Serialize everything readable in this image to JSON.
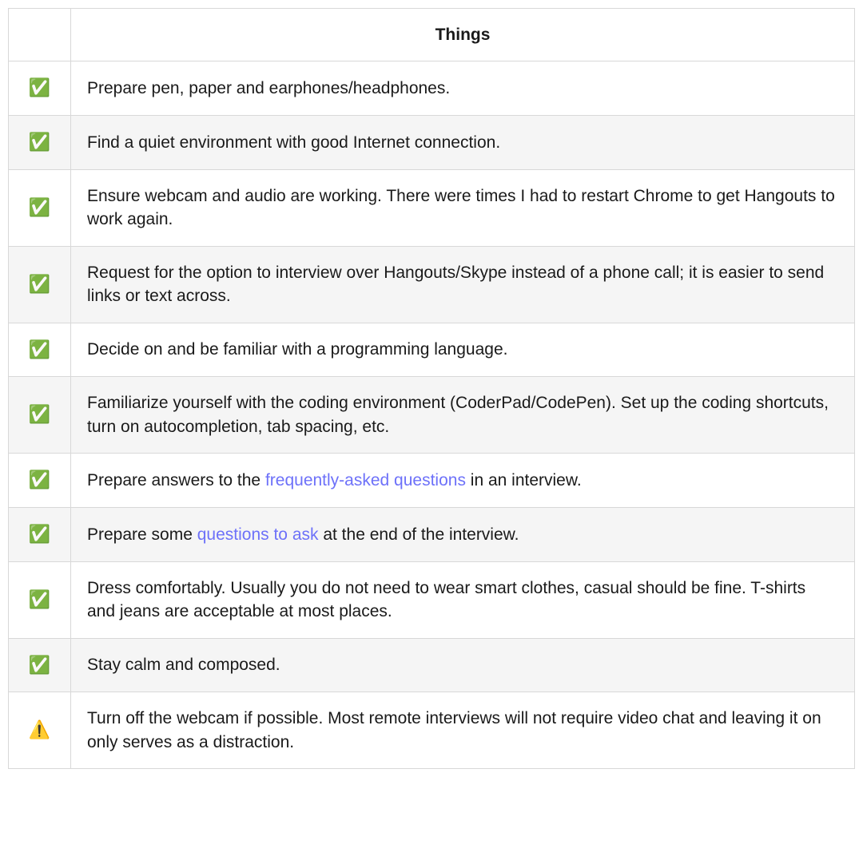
{
  "table": {
    "header": {
      "col1": "",
      "col2": "Things"
    },
    "icons": {
      "check": "✅",
      "warn": "⚠️"
    },
    "rows": [
      {
        "icon": "check",
        "segments": [
          {
            "type": "text",
            "text": "Prepare pen, paper and earphones/headphones."
          }
        ]
      },
      {
        "icon": "check",
        "segments": [
          {
            "type": "text",
            "text": "Find a quiet environment with good Internet connection."
          }
        ]
      },
      {
        "icon": "check",
        "segments": [
          {
            "type": "text",
            "text": "Ensure webcam and audio are working. There were times I had to restart Chrome to get Hangouts to work again."
          }
        ]
      },
      {
        "icon": "check",
        "segments": [
          {
            "type": "text",
            "text": "Request for the option to interview over Hangouts/Skype instead of a phone call; it is easier to send links or text across."
          }
        ]
      },
      {
        "icon": "check",
        "segments": [
          {
            "type": "text",
            "text": "Decide on and be familiar with a programming language."
          }
        ]
      },
      {
        "icon": "check",
        "segments": [
          {
            "type": "text",
            "text": "Familiarize yourself with the coding environment (CoderPad/CodePen). Set up the coding shortcuts, turn on autocompletion, tab spacing, etc."
          }
        ]
      },
      {
        "icon": "check",
        "segments": [
          {
            "type": "text",
            "text": "Prepare answers to the "
          },
          {
            "type": "link",
            "text": "frequently-asked questions"
          },
          {
            "type": "text",
            "text": " in an interview."
          }
        ]
      },
      {
        "icon": "check",
        "segments": [
          {
            "type": "text",
            "text": "Prepare some "
          },
          {
            "type": "link",
            "text": "questions to ask"
          },
          {
            "type": "text",
            "text": " at the end of the interview."
          }
        ]
      },
      {
        "icon": "check",
        "segments": [
          {
            "type": "text",
            "text": "Dress comfortably. Usually you do not need to wear smart clothes, casual should be fine. T-shirts and jeans are acceptable at most places."
          }
        ]
      },
      {
        "icon": "check",
        "segments": [
          {
            "type": "text",
            "text": "Stay calm and composed."
          }
        ]
      },
      {
        "icon": "warn",
        "segments": [
          {
            "type": "text",
            "text": "Turn off the webcam if possible. Most remote interviews will not require video chat and leaving it on only serves as a distraction."
          }
        ]
      }
    ]
  }
}
